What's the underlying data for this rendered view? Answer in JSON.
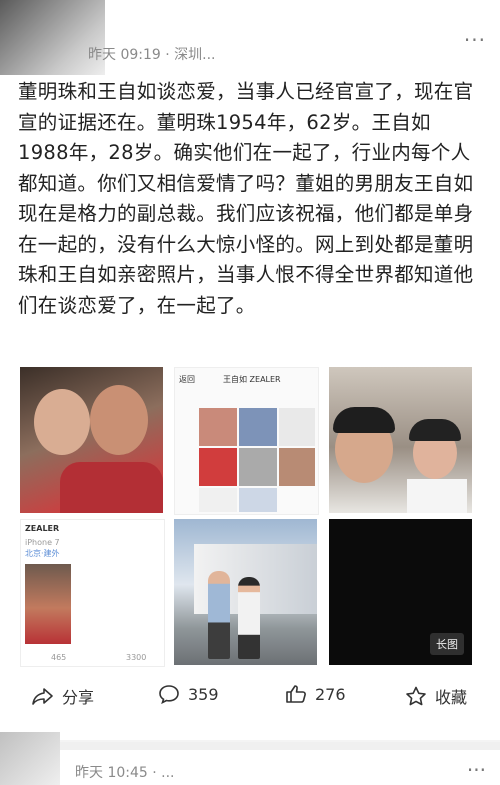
{
  "post": {
    "time": "昨天 09:19 · 深圳...",
    "text": "董明珠和王自如谈恋爱，当事人已经官宣了，现在官宣的证据还在。董明珠1954年，62岁。王自如1988年，28岁。确实他们在一起了，行业内每个人都知道。你们又相信爱情了吗？董姐的男朋友王自如现在是格力的副总裁。我们应该祝福，他们都是单身在一起的，没有什么大惊小怪的。网上到处都是董明珠和王自如亲密照片，当事人恨不得全世界都知道他们在谈恋爱了，在一起了。",
    "more_icon": "more-dots-icon"
  },
  "images": {
    "zealer_header": "王自如 ZEALER",
    "zealer_back": "返回",
    "t4_name": "ZEALER",
    "t4_sub": "iPhone 7",
    "t4_loc": "北京·建外",
    "t4_like": "465",
    "t4_comment": "3300",
    "long_image_label": "长图"
  },
  "actions": {
    "share_label": "分享",
    "comment_count": "359",
    "like_count": "276",
    "favorite_label": "收藏"
  },
  "next_post": {
    "time": "昨天 10:45 · ..."
  }
}
